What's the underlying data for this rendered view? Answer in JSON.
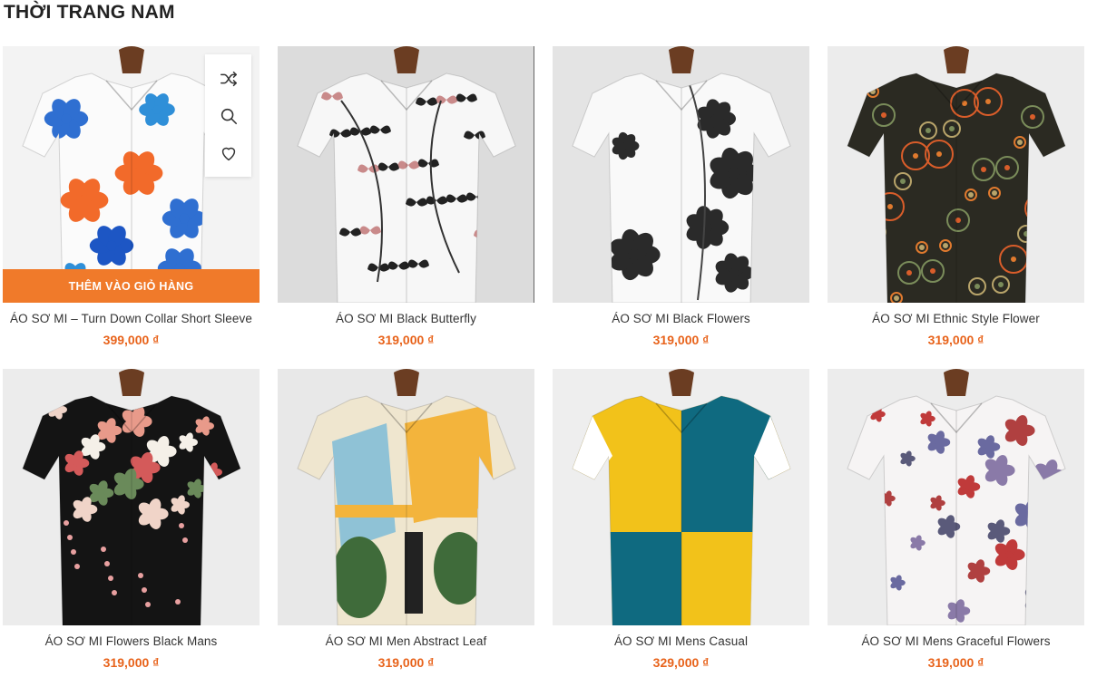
{
  "section": {
    "title": "THỜI TRANG NAM"
  },
  "hover_card": {
    "add_to_cart_label": "THÊM VÀO GIỎ HÀNG",
    "actions": [
      {
        "icon": "shuffle-icon",
        "name": "compare-button"
      },
      {
        "icon": "search-icon",
        "name": "quick-view-button"
      },
      {
        "icon": "heart-icon",
        "name": "wishlist-button"
      }
    ]
  },
  "products": [
    {
      "name": "ÁO SƠ MI – Turn Down Collar Short Sleeve",
      "price": "399,000 ₫",
      "pattern": "blue-orange-floral",
      "bg": "#f3f3f3",
      "shirt": "#fbfbfb"
    },
    {
      "name": "ÁO SƠ MI Black Butterfly",
      "price": "319,000 ₫",
      "pattern": "black-butterfly",
      "bg": "#dcdcdc",
      "shirt": "#f7f7f7"
    },
    {
      "name": "ÁO SƠ MI Black Flowers",
      "price": "319,000 ₫",
      "pattern": "black-ink-flowers",
      "bg": "#e4e4e4",
      "shirt": "#f9f9f9"
    },
    {
      "name": "ÁO SƠ MI Ethnic Style Flower",
      "price": "319,000 ₫",
      "pattern": "ethnic-paisley",
      "bg": "#ececec",
      "shirt": "#2b2a22"
    },
    {
      "name": "ÁO SƠ MI Flowers Black Mans",
      "price": "319,000 ₫",
      "pattern": "black-floral",
      "bg": "#ececec",
      "shirt": "#141414"
    },
    {
      "name": "ÁO SƠ MI Men Abstract Leaf",
      "price": "319,000 ₫",
      "pattern": "abstract-leaf",
      "bg": "#e8e8e8",
      "shirt": "#efe6cf"
    },
    {
      "name": "ÁO SƠ MI Mens Casual",
      "price": "329,000 ₫",
      "pattern": "color-block",
      "bg": "#eeeeee",
      "shirt": "#f2c21a"
    },
    {
      "name": "ÁO SƠ MI Mens Graceful Flowers",
      "price": "319,000 ₫",
      "pattern": "graceful-flowers",
      "bg": "#ececec",
      "shirt": "#f6f4f4"
    }
  ],
  "colors": {
    "price": "#e8631b",
    "add_to_cart_bg": "#f07a2a"
  }
}
